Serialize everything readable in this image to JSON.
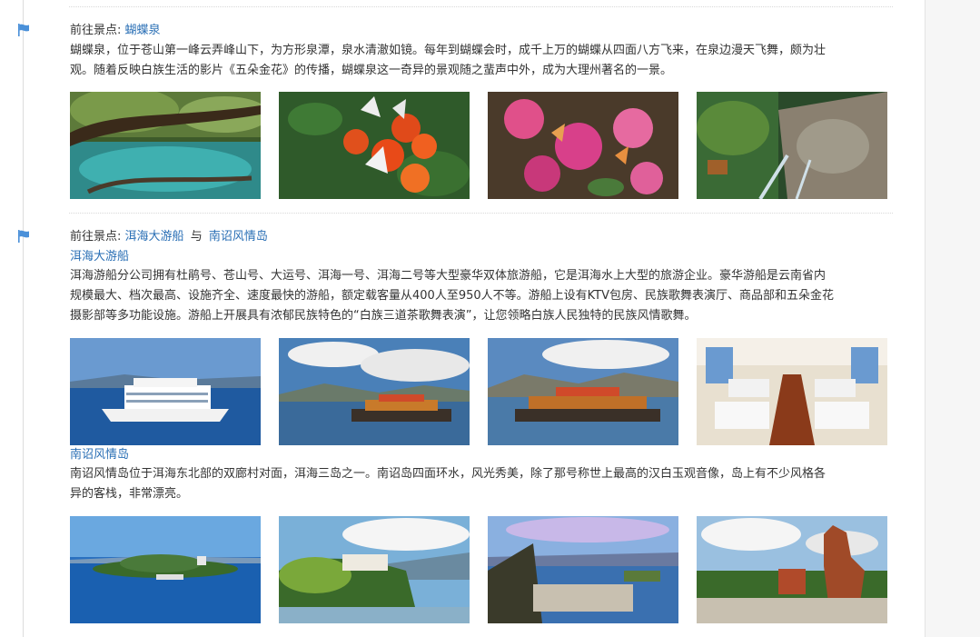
{
  "sections": [
    {
      "prefix": "前往景点:",
      "spot": "蝴蝶泉",
      "description_lines": [
        "蝴蝶泉，位于苍山第一峰云弄峰山下，为方形泉潭，泉水清澈如镜。每年到蝴蝶会时，成千上万的蝴蝶从四面八方飞来，在泉边漫天飞舞，颇为壮",
        "观。随着反映白族生活的影片《五朵金花》的传播，蝴蝶泉这一奇异的景观随之蜚声中外，成为大理州著名的一景。"
      ]
    },
    {
      "prefix": "前往景点:",
      "spot_a": "洱海大游船",
      "joiner": "与",
      "spot_b": "南诏风情岛",
      "sub_a": {
        "title": "洱海大游船",
        "description_lines": [
          "洱海游船分公司拥有杜鹃号、苍山号、大运号、洱海一号、洱海二号等大型豪华双体旅游船，它是洱海水上大型的旅游企业。豪华游船是云南省内",
          "规模最大、档次最高、设施齐全、速度最快的游船，额定载客量从400人至950人不等。游船上设有KTV包房、民族歌舞表演厅、商品部和五朵金花",
          "摄影部等多功能设施。游船上开展具有浓郁民族特色的“白族三道茶歌舞表演”，让您领略白族人民独特的民族风情歌舞。"
        ]
      },
      "sub_b": {
        "title": "南诏风情岛",
        "description_lines": [
          "南诏风情岛位于洱海东北部的双廊村对面，洱海三岛之一。南诏岛四面环水，风光秀美，除了那号称世上最高的汉白玉观音像，岛上有不少风格各",
          "异的客栈，非常漂亮。"
        ]
      }
    }
  ],
  "icons": {
    "section_marker": "flag-icon"
  },
  "colors": {
    "link": "#2a6fb5",
    "flag": "#4a90d9",
    "text": "#333333"
  }
}
